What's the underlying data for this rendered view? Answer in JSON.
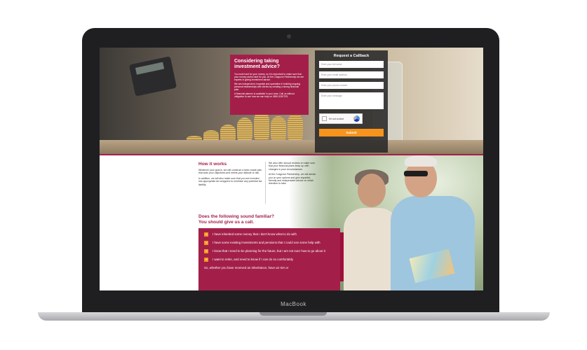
{
  "device": {
    "brand": "MacBook"
  },
  "hero": {
    "heading": "Considering taking investment advice?",
    "paragraphs": [
      "You work hard for your money, so it is important to make sure that your money works hard for you. At the Cosgrove Partnership we are experts in giving investment advice.",
      "We are independent, impartial and specialise in building ongoing personal relationships with clients by creating a strong financial plan.",
      "A financial planner is available in your area. Call us without obligation to see how we can help on 0800-3287375."
    ]
  },
  "callback_form": {
    "title": "Request a Callback",
    "name_placeholder": "Enter your full name",
    "email_placeholder": "Enter your email address",
    "phone_placeholder": "Enter your phone number",
    "message_placeholder": "Enter your message",
    "captcha_label": "I'm not a robot",
    "submit_label": "Submit"
  },
  "how_it_works": {
    "title": "How it works",
    "col1": [
      "Whatever your goal is, we will construct a tailor-made plan that suits your objectives and meets your attitude to risk.",
      "In addition, we will also make sure that you are invested into appropriate tax wrappers to minimise any potential tax liability."
    ],
    "col2": [
      "We also offer annual reviews to make sure that your financial plans keep up with changes in your circumstances.",
      "At the Cosgrove Partnership, we will advise you on your options and give impartial, friendly and independent advice on which direction to take."
    ]
  },
  "familiar": {
    "title_line1": "Does the following sound familiar?",
    "title_line2": "You should give us a call.",
    "items": [
      "I have inherited some money that I don't know what to do with",
      "I have some existing investments and pensions that I could use some help with",
      "I know that I need to be planning for the future, but I am not sure how to go about it",
      "I want to retire, and need to know if I can do so comfortably"
    ],
    "footer": "So, whether you have received an inheritance, have an ISA or"
  },
  "colors": {
    "brand": "#a31f4a",
    "accent": "#f7941d",
    "form_bg": "#2b2b2b"
  },
  "icons": {
    "bullet": "arrow-right-icon"
  }
}
